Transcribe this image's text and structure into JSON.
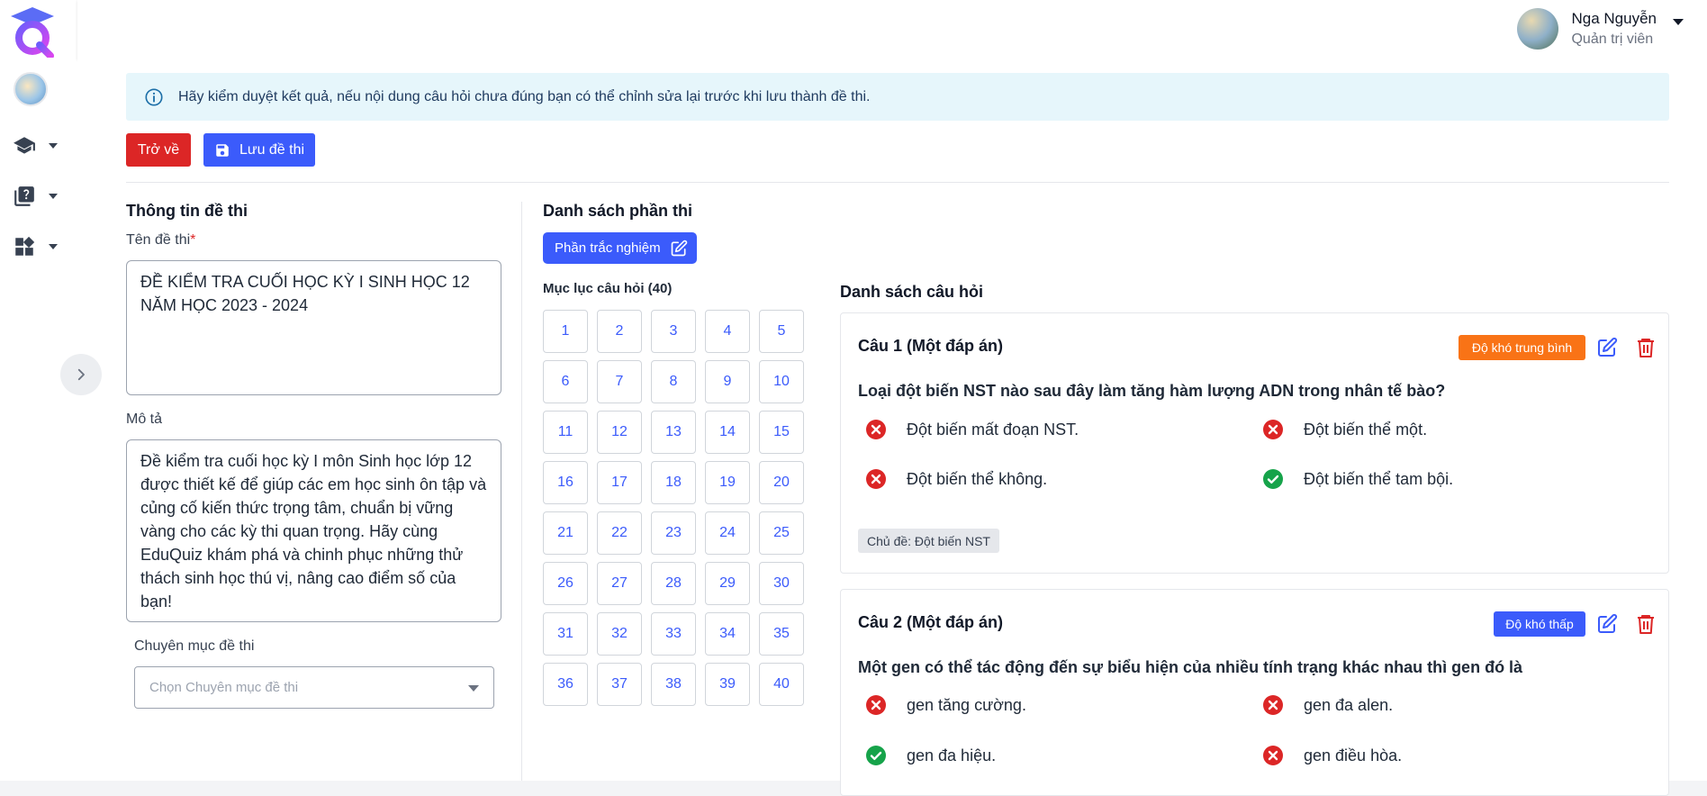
{
  "user": {
    "name": "Nga Nguyễn",
    "role": "Quản trị viên"
  },
  "alert": {
    "text": "Hãy kiểm duyệt kết quả, nếu nội dung câu hỏi chưa đúng bạn có thể chỉnh sửa lại trước khi lưu thành đề thi."
  },
  "toolbar": {
    "back_label": "Trở về",
    "save_label": "Lưu đề thi"
  },
  "exam_info": {
    "heading": "Thông tin đề thi",
    "name_label": "Tên đề thi",
    "required_mark": "*",
    "name_value": "ĐỀ KIỂM TRA CUỐI HỌC KỲ I SINH HỌC 12 NĂM HỌC 2023 - 2024",
    "desc_label": "Mô tả",
    "desc_value": "Đề kiểm tra cuối học kỳ I môn Sinh học lớp 12 được thiết kế để giúp các em học sinh ôn tập và củng cố kiến thức trọng tâm, chuẩn bị vững vàng cho các kỳ thi quan trọng. Hãy cùng EduQuiz khám phá và chinh phục những thử thách sinh học thú vị, nâng cao điểm số của bạn!",
    "category_label": "Chuyên mục đề thi",
    "category_placeholder": "Chọn Chuyên mục đề thi"
  },
  "parts": {
    "heading": "Danh sách phần thi",
    "part_label": "Phần trắc nghiệm",
    "index_label": "Mục lục câu hỏi (40)",
    "numbers": [
      "1",
      "2",
      "3",
      "4",
      "5",
      "6",
      "7",
      "8",
      "9",
      "10",
      "11",
      "12",
      "13",
      "14",
      "15",
      "16",
      "17",
      "18",
      "19",
      "20",
      "21",
      "22",
      "23",
      "24",
      "25",
      "26",
      "27",
      "28",
      "29",
      "30",
      "31",
      "32",
      "33",
      "34",
      "35",
      "36",
      "37",
      "38",
      "39",
      "40"
    ]
  },
  "questions": {
    "heading": "Danh sách câu hỏi",
    "items": [
      {
        "title": "Câu 1 (Một đáp án)",
        "difficulty": "Độ khó trung bình",
        "difficulty_color": "#f97316",
        "text": "Loại đột biến NST nào sau đây làm tăng hàm lượng ADN trong nhân tế bào?",
        "options": [
          {
            "text": "Đột biến mất đoạn NST.",
            "correct": false
          },
          {
            "text": "Đột biến thể một.",
            "correct": false
          },
          {
            "text": "Đột biến thể không.",
            "correct": false
          },
          {
            "text": "Đột biến thể tam bội.",
            "correct": true
          }
        ],
        "topic": "Chủ đề: Đột biến NST"
      },
      {
        "title": "Câu 2 (Một đáp án)",
        "difficulty": "Độ khó thấp",
        "difficulty_color": "#3b5bfb",
        "text": "Một gen có thể tác động đến sự biểu hiện của nhiều tính trạng khác nhau thì gen đó là",
        "options": [
          {
            "text": "gen tăng cường.",
            "correct": false
          },
          {
            "text": "gen đa alen.",
            "correct": false
          },
          {
            "text": "gen đa hiệu.",
            "correct": true
          },
          {
            "text": "gen điều hòa.",
            "correct": false
          }
        ]
      }
    ]
  },
  "colors": {
    "primary": "#3b5bfb",
    "danger": "#dc2626",
    "success": "#16a34a",
    "warning": "#f97316"
  }
}
